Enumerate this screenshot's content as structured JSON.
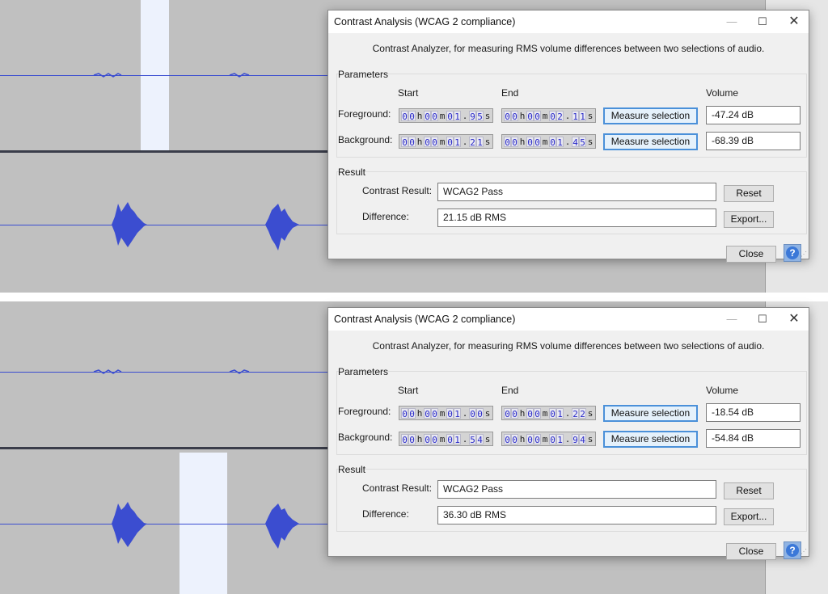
{
  "dialogs": [
    {
      "title": "Contrast Analysis (WCAG 2 compliance)",
      "description": "Contrast Analyzer, for measuring RMS volume differences between two selections of audio.",
      "parameters_label": "Parameters",
      "col_start": "Start",
      "col_end": "End",
      "col_volume": "Volume",
      "foreground": {
        "label": "Foreground:",
        "start": [
          "0",
          "0",
          "h",
          "0",
          "0",
          "m",
          "0",
          "1",
          ".",
          "9",
          "5",
          "s"
        ],
        "end": [
          "0",
          "0",
          "h",
          "0",
          "0",
          "m",
          "0",
          "2",
          ".",
          "1",
          "1",
          "s"
        ],
        "button": "Measure selection",
        "volume": "-47.24 dB"
      },
      "background": {
        "label": "Background:",
        "start": [
          "0",
          "0",
          "h",
          "0",
          "0",
          "m",
          "0",
          "1",
          ".",
          "2",
          "1",
          "s"
        ],
        "end": [
          "0",
          "0",
          "h",
          "0",
          "0",
          "m",
          "0",
          "1",
          ".",
          "4",
          "5",
          "s"
        ],
        "button": "Measure selection",
        "volume": "-68.39 dB"
      },
      "result_label": "Result",
      "contrast_label": "Contrast Result:",
      "contrast_value": "WCAG2 Pass",
      "difference_label": "Difference:",
      "difference_value": "21.15 dB RMS",
      "reset": "Reset",
      "export": "Export...",
      "close": "Close",
      "help": "?"
    },
    {
      "title": "Contrast Analysis (WCAG 2 compliance)",
      "description": "Contrast Analyzer, for measuring RMS volume differences between two selections of audio.",
      "parameters_label": "Parameters",
      "col_start": "Start",
      "col_end": "End",
      "col_volume": "Volume",
      "foreground": {
        "label": "Foreground:",
        "start": [
          "0",
          "0",
          "h",
          "0",
          "0",
          "m",
          "0",
          "1",
          ".",
          "0",
          "0",
          "s"
        ],
        "end": [
          "0",
          "0",
          "h",
          "0",
          "0",
          "m",
          "0",
          "1",
          ".",
          "2",
          "2",
          "s"
        ],
        "button": "Measure selection",
        "volume": "-18.54 dB"
      },
      "background": {
        "label": "Background:",
        "start": [
          "0",
          "0",
          "h",
          "0",
          "0",
          "m",
          "0",
          "1",
          ".",
          "5",
          "4",
          "s"
        ],
        "end": [
          "0",
          "0",
          "h",
          "0",
          "0",
          "m",
          "0",
          "1",
          ".",
          "9",
          "4",
          "s"
        ],
        "button": "Measure selection",
        "volume": "-54.84 dB"
      },
      "result_label": "Result",
      "contrast_label": "Contrast Result:",
      "contrast_value": "WCAG2 Pass",
      "difference_label": "Difference:",
      "difference_value": "36.30 dB RMS",
      "reset": "Reset",
      "export": "Export...",
      "close": "Close",
      "help": "?"
    }
  ],
  "colors": {
    "waveform": "#3b4dd0",
    "selection": "#edf2fd",
    "accent_button_border": "#4a90d9"
  },
  "icons": {
    "minimize": "minimize-icon",
    "maximize": "maximize-icon",
    "close": "close-icon",
    "help": "help-icon"
  }
}
